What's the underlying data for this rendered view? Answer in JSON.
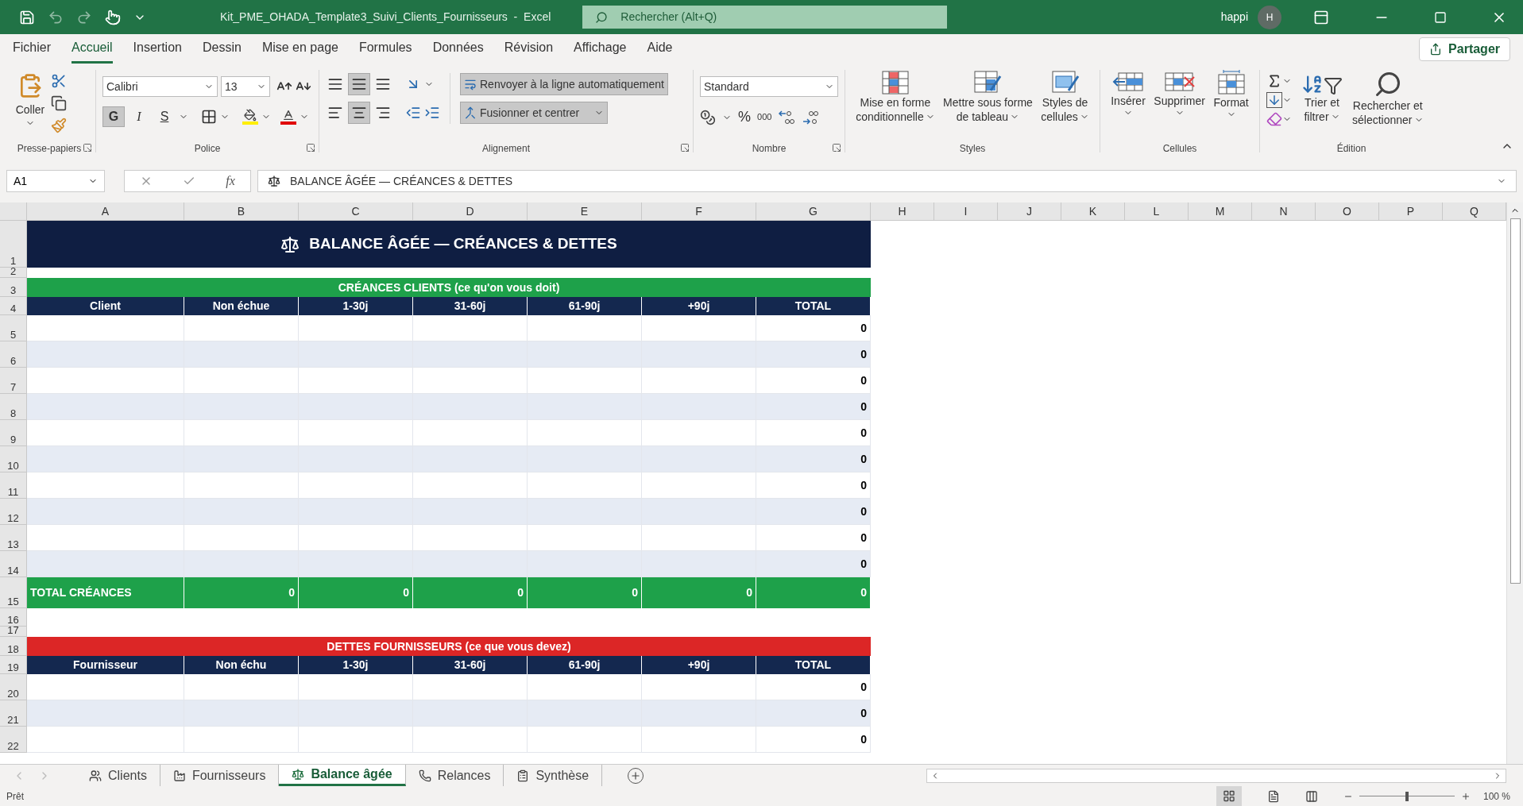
{
  "title_bar": {
    "document": "Kit_PME_OHADA_Template3_Suivi_Clients_Fournisseurs  -  Excel",
    "search_placeholder": "Rechercher (Alt+Q)",
    "user": "happi",
    "avatar": "H"
  },
  "menu_tabs": [
    {
      "label": "Fichier",
      "selected": false
    },
    {
      "label": "Accueil",
      "selected": true
    },
    {
      "label": "Insertion",
      "selected": false
    },
    {
      "label": "Dessin",
      "selected": false
    },
    {
      "label": "Mise en page",
      "selected": false
    },
    {
      "label": "Formules",
      "selected": false
    },
    {
      "label": "Données",
      "selected": false
    },
    {
      "label": "Révision",
      "selected": false
    },
    {
      "label": "Affichage",
      "selected": false
    },
    {
      "label": "Aide",
      "selected": false
    }
  ],
  "share_button": "Partager",
  "ribbon": {
    "clipboard": {
      "label": "Presse-papiers",
      "paste": "Coller"
    },
    "font": {
      "label": "Police",
      "font_name": "Calibri",
      "font_size": "13",
      "format_buttons": [
        {
          "kind": "bold",
          "label": "G",
          "on": true
        },
        {
          "kind": "italic",
          "label": "I",
          "on": false
        },
        {
          "kind": "underline",
          "label": "S",
          "on": false
        }
      ]
    },
    "alignment": {
      "label": "Alignement",
      "middle_align": true,
      "center_align": true,
      "wrap_text": {
        "label": "Renvoyer à la ligne automatiquement",
        "on": true
      },
      "merge": {
        "label": "Fusionner et centrer",
        "on": true
      }
    },
    "number": {
      "label": "Nombre",
      "format": "Standard",
      "percent": "%",
      "thousands": "000"
    },
    "styles": {
      "label": "Styles",
      "buttons": [
        {
          "kind": "conditional",
          "lines": [
            "Mise en forme",
            "conditionnelle"
          ]
        },
        {
          "kind": "table",
          "lines": [
            "Mettre sous forme",
            "de tableau"
          ]
        },
        {
          "kind": "cellstyle",
          "lines": [
            "Styles de",
            "cellules"
          ]
        }
      ]
    },
    "cells": {
      "label": "Cellules",
      "buttons": [
        {
          "kind": "insert",
          "label": "Insérer"
        },
        {
          "kind": "delete",
          "label": "Supprimer"
        },
        {
          "kind": "format",
          "label": "Format"
        }
      ]
    },
    "editing": {
      "label": "Édition",
      "buttons": [
        {
          "kind": "sort",
          "lines": [
            "Trier et",
            "filtrer"
          ]
        },
        {
          "kind": "find",
          "lines": [
            "Rechercher et",
            "sélectionner"
          ]
        }
      ]
    }
  },
  "formula_bar": {
    "name_box": "A1",
    "function_label": "fx",
    "formula": "BALANCE ÂGÉE — CRÉANCES & DETTES"
  },
  "sheet": {
    "columns": [
      "A",
      "B",
      "C",
      "D",
      "E",
      "F",
      "G",
      "H",
      "I",
      "J",
      "K",
      "L",
      "M",
      "N",
      "O",
      "P",
      "Q"
    ],
    "rows": [
      {
        "number": "1",
        "kind": "title",
        "text": "BALANCE ÂGÉE — CRÉANCES & DETTES"
      },
      {
        "number": "2",
        "kind": "thin"
      },
      {
        "number": "3",
        "kind": "band",
        "text": "CRÉANCES CLIENTS (ce qu'on vous doit)",
        "color": "#1ea14a"
      },
      {
        "number": "4",
        "kind": "header",
        "cells": [
          "Client",
          "Non échue",
          "1-30j",
          "31-60j",
          "61-90j",
          "+90j",
          "TOTAL"
        ]
      },
      {
        "number": "5",
        "kind": "data",
        "shaded": false,
        "total": "0"
      },
      {
        "number": "6",
        "kind": "data",
        "shaded": true,
        "total": "0"
      },
      {
        "number": "7",
        "kind": "data",
        "shaded": false,
        "total": "0"
      },
      {
        "number": "8",
        "kind": "data",
        "shaded": true,
        "total": "0"
      },
      {
        "number": "9",
        "kind": "data",
        "shaded": false,
        "total": "0"
      },
      {
        "number": "10",
        "kind": "data",
        "shaded": true,
        "total": "0"
      },
      {
        "number": "11",
        "kind": "data",
        "shaded": false,
        "total": "0"
      },
      {
        "number": "12",
        "kind": "data",
        "shaded": true,
        "total": "0"
      },
      {
        "number": "13",
        "kind": "data",
        "shaded": false,
        "total": "0"
      },
      {
        "number": "14",
        "kind": "data",
        "shaded": true,
        "total": "0"
      },
      {
        "number": "15",
        "kind": "total",
        "label": "TOTAL CRÉANCES",
        "values": [
          "0",
          "0",
          "0",
          "0",
          "0",
          "0"
        ]
      },
      {
        "number": "16",
        "kind": "blank"
      },
      {
        "number": "17",
        "kind": "thin"
      },
      {
        "number": "18",
        "kind": "band",
        "text": "DETTES FOURNISSEURS (ce que vous devez)",
        "color": "#dc2626"
      },
      {
        "number": "19",
        "kind": "header",
        "cells": [
          "Fournisseur",
          "Non échu",
          "1-30j",
          "31-60j",
          "61-90j",
          "+90j",
          "TOTAL"
        ]
      },
      {
        "number": "20",
        "kind": "data",
        "shaded": false,
        "total": "0"
      },
      {
        "number": "21",
        "kind": "data",
        "shaded": true,
        "total": "0"
      },
      {
        "number": "22",
        "kind": "data",
        "shaded": false,
        "total": "0"
      }
    ]
  },
  "sheet_tabs": [
    {
      "kind": "people",
      "label": "Clients",
      "selected": false
    },
    {
      "kind": "factory",
      "label": "Fournisseurs",
      "selected": false
    },
    {
      "kind": "scale",
      "label": "Balance âgée",
      "selected": true
    },
    {
      "kind": "phone",
      "label": "Relances",
      "selected": false
    },
    {
      "kind": "clipboard",
      "label": "Synthèse",
      "selected": false
    }
  ],
  "status_bar": {
    "status": "Prêt",
    "zoom": "100 %",
    "zoom_slider": {
      "level": 0.5
    }
  }
}
